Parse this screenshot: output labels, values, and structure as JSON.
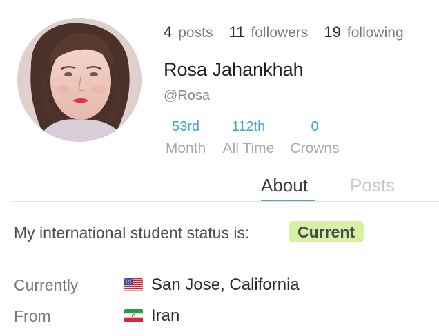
{
  "profile": {
    "display_name": "Rosa Jahankhah",
    "username": "@Rosa",
    "avatar_icon": "profile-photo"
  },
  "stats": [
    {
      "value": "4",
      "label": "posts"
    },
    {
      "value": "11",
      "label": "followers"
    },
    {
      "value": "19",
      "label": "following"
    }
  ],
  "ranks": {
    "month": {
      "value": "53rd",
      "label": "Month"
    },
    "all_time": {
      "value": "112th",
      "label": "All Time"
    },
    "crowns": {
      "value": "0",
      "label": "Crowns"
    }
  },
  "tabs": [
    {
      "label": "About",
      "active": true
    },
    {
      "label": "Posts",
      "active": false
    }
  ],
  "about": {
    "status_text": "My international student status is:",
    "status_badge": "Current",
    "currently": {
      "label": "Currently",
      "flag_icon": "us-flag-icon",
      "value": "San Jose, California"
    },
    "from": {
      "label": "From",
      "flag_icon": "iran-flag-icon",
      "value": "Iran"
    }
  },
  "colors": {
    "accent": "#3ea4d8",
    "badge_bg": "#d7f0a3",
    "tab_underline": "#48a7d6"
  }
}
